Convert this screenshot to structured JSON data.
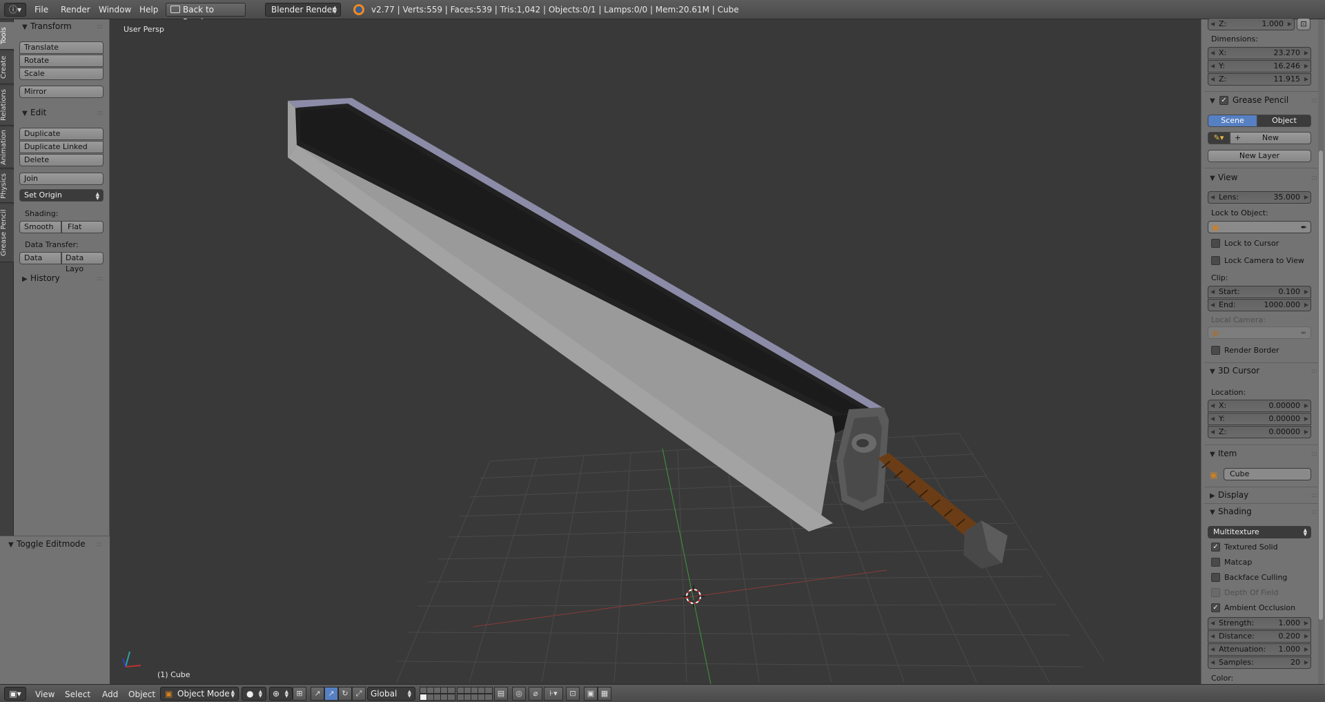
{
  "topbar": {
    "info_icon": "info-icon",
    "menus": [
      "File",
      "Render",
      "Window",
      "Help"
    ],
    "back_button": "Back to Previous",
    "render_engine": "Blender Render",
    "stats": "v2.77 | Verts:559 | Faces:539 | Tris:1,042 | Objects:0/1 | Lamps:0/0 | Mem:20.61M | Cube"
  },
  "left_tabs": [
    "Tools",
    "Create",
    "Relations",
    "Animation",
    "Physics",
    "Grease Pencil"
  ],
  "tools": {
    "transform_header": "Transform",
    "translate": "Translate",
    "rotate": "Rotate",
    "scale": "Scale",
    "mirror": "Mirror",
    "edit_header": "Edit",
    "duplicate": "Duplicate",
    "duplicate_linked": "Duplicate Linked",
    "delete": "Delete",
    "join": "Join",
    "set_origin": "Set Origin",
    "shading_label": "Shading:",
    "smooth": "Smooth",
    "flat": "Flat",
    "data_transfer_label": "Data Transfer:",
    "data": "Data",
    "data_layout": "Data Layo",
    "history_header": "History"
  },
  "operator_panel": {
    "header": "Toggle Editmode"
  },
  "viewport": {
    "view_name": "User Persp",
    "object_label": "(1) Cube"
  },
  "properties": {
    "scale_z": {
      "label": "Z:",
      "value": "1.000"
    },
    "dimensions_label": "Dimensions:",
    "dimensions": [
      {
        "label": "X:",
        "value": "23.270"
      },
      {
        "label": "Y:",
        "value": "16.246"
      },
      {
        "label": "Z:",
        "value": "11.915"
      }
    ],
    "grease_pencil": {
      "header": "Grease Pencil",
      "enabled": true,
      "scene": "Scene",
      "object": "Object",
      "new": "New",
      "new_layer": "New Layer"
    },
    "view": {
      "header": "View",
      "lens_label": "Lens:",
      "lens_value": "35.000",
      "lock_to_object": "Lock to Object:",
      "lock_to_cursor": "Lock to Cursor",
      "lock_camera": "Lock Camera to View",
      "clip_label": "Clip:",
      "clip_start_label": "Start:",
      "clip_start": "0.100",
      "clip_end_label": "End:",
      "clip_end": "1000.000",
      "local_camera": "Local Camera:",
      "render_border": "Render Border"
    },
    "cursor": {
      "header": "3D Cursor",
      "location_label": "Location:",
      "coords": [
        {
          "label": "X:",
          "value": "0.00000"
        },
        {
          "label": "Y:",
          "value": "0.00000"
        },
        {
          "label": "Z:",
          "value": "0.00000"
        }
      ]
    },
    "item": {
      "header": "Item",
      "name": "Cube"
    },
    "display": {
      "header": "Display"
    },
    "shading": {
      "header": "Shading",
      "mode": "Multitexture",
      "textured_solid": "Textured Solid",
      "matcap": "Matcap",
      "backface_culling": "Backface Culling",
      "depth_of_field": "Depth Of Field",
      "ambient_occlusion": "Ambient Occlusion",
      "strength_label": "Strength:",
      "strength": "1.000",
      "distance_label": "Distance:",
      "distance": "0.200",
      "attenuation_label": "Attenuation:",
      "attenuation": "1.000",
      "samples_label": "Samples:",
      "samples": "20",
      "color_label": "Color:"
    }
  },
  "bottombar": {
    "menus": [
      "View",
      "Select",
      "Add",
      "Object"
    ],
    "mode": "Object Mode",
    "orientation": "Global"
  },
  "colors": {
    "accent_blue": "#5680c2",
    "background": "#393939",
    "panel": "#737373"
  }
}
